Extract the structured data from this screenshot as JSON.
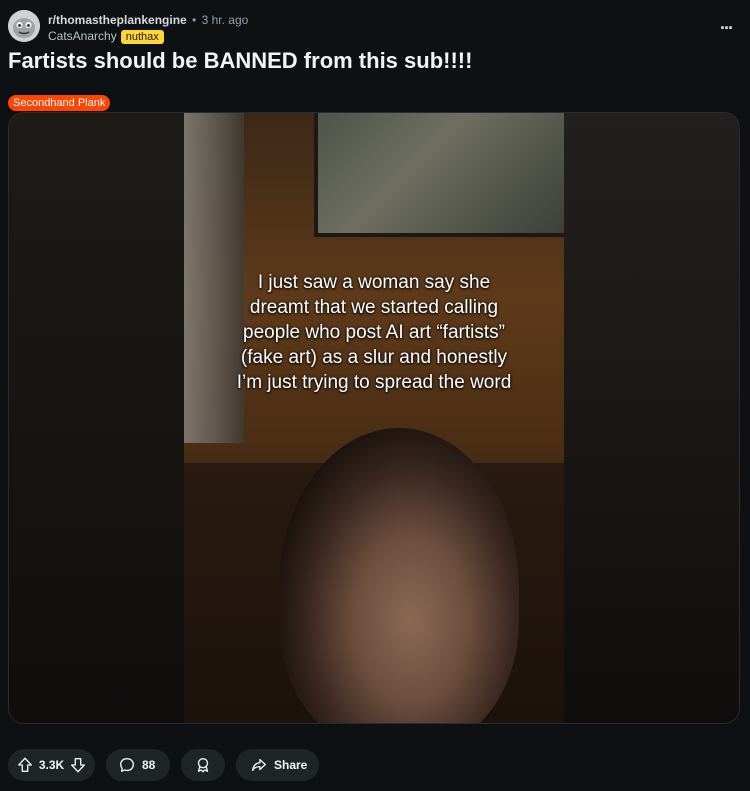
{
  "post": {
    "subreddit": "r/thomastheplankengine",
    "separator": "•",
    "time_ago": "3 hr. ago",
    "author": "CatsAnarchy",
    "author_flair": "nuthax",
    "title": "Fartists should be BANNED from this sub!!!!",
    "post_flair": "Secondhand Plank",
    "more_options": "..."
  },
  "media": {
    "caption": "I just saw a woman say she dreamt that we started calling people who post AI art “fartists” (fake art) as a slur and honestly I’m just trying to spread the word"
  },
  "actions": {
    "vote_count": "3.3K",
    "comment_count": "88",
    "share_label": "Share"
  },
  "icons": {
    "upvote": "upvote-icon",
    "downvote": "downvote-icon",
    "comment": "comment-icon",
    "award": "award-icon",
    "share": "share-icon",
    "more": "more-icon"
  }
}
